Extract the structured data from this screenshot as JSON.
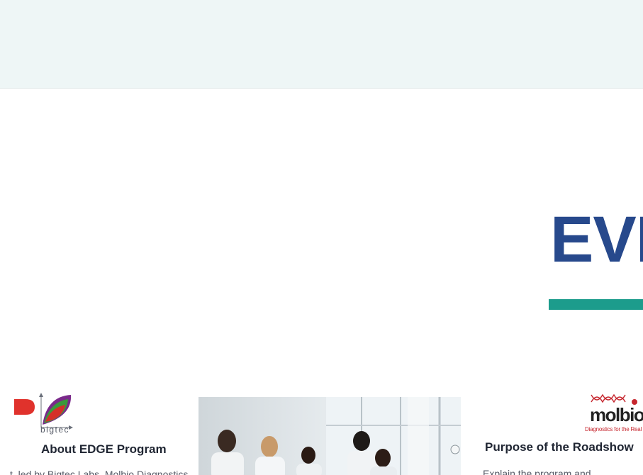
{
  "hero": {
    "title": "EVI"
  },
  "left_column": {
    "logo_text": "bigtec",
    "heading": "About EDGE Program",
    "body_snippet": "t, led by Bigtec Labs, Molbio Diagnostics"
  },
  "right_column": {
    "logo_word": "molbio",
    "logo_tagline": "Diagnostics for the Real World",
    "heading": "Purpose of the Roadshow",
    "body_snippet": "Explain the program and"
  },
  "photo": {
    "description_icon": "lab-team-photo"
  },
  "colors": {
    "top_band": "#eef6f6",
    "hero_title": "#27498c",
    "accent_teal": "#1c9c8c",
    "logo_red": "#e0322c",
    "logo_green": "#3a9a3c",
    "logo_purple": "#7a2a8a",
    "heading_text": "#1f2532",
    "body_text": "#555a66"
  }
}
